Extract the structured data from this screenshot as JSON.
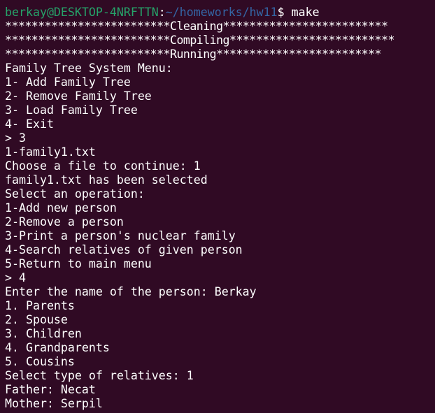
{
  "prompt": {
    "user_host": "berkay@DESKTOP-4NRFTTN",
    "separator": ":",
    "path": "~/homeworks/hw11",
    "symbol": "$ ",
    "command": "make"
  },
  "build_lines": [
    "*************************Cleaning*************************",
    "*************************Compiling*************************",
    "*************************Running*************************"
  ],
  "output_lines": [
    "Family Tree System Menu:",
    "1- Add Family Tree",
    "2- Remove Family Tree",
    "3- Load Family Tree",
    "4- Exit",
    "> 3",
    "1-family1.txt",
    "Choose a file to continue: 1",
    "family1.txt has been selected",
    "Select an operation:",
    "1-Add new person",
    "2-Remove a person",
    "3-Print a person's nuclear family",
    "4-Search relatives of given person",
    "5-Return to main menu",
    "> 4",
    "Enter the name of the person: Berkay",
    "1. Parents",
    "2. Spouse",
    "3. Children",
    "4. Grandparents",
    "5. Cousins",
    "Select type of relatives: 1",
    "Father: Necat",
    "Mother: Serpil"
  ],
  "colors": {
    "background": "#300a24",
    "text": "#ffffff",
    "user_host": "#26a269",
    "path": "#3465a4"
  }
}
